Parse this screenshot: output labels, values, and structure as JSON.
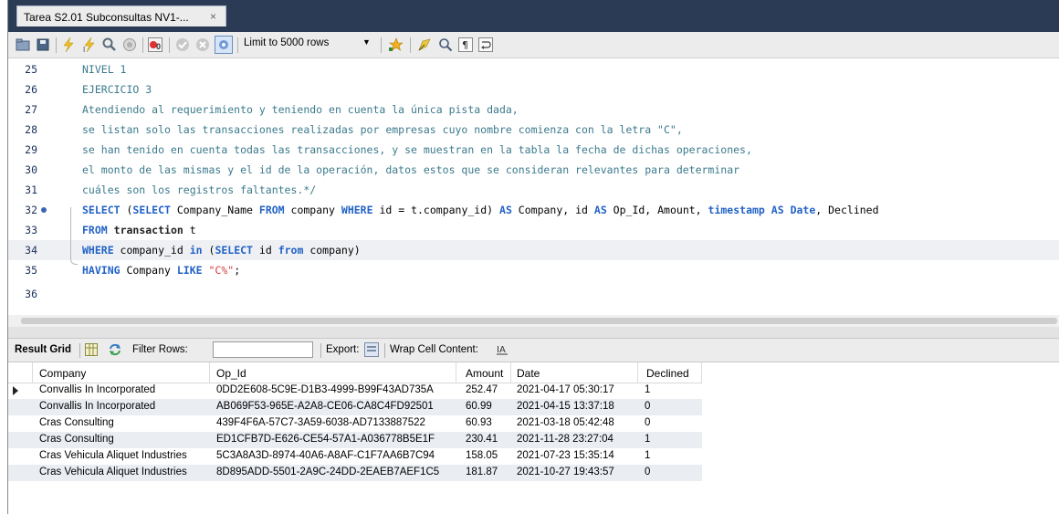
{
  "tab": {
    "title": "Tarea S2.01 Subconsultas NV1-...",
    "close": "×"
  },
  "toolbar": {
    "limit_label": "Limit to 5000 rows"
  },
  "editor": {
    "lines": [
      {
        "num": "25",
        "text": "NIVEL 1"
      },
      {
        "num": "26",
        "text": "EJERCICIO 3"
      },
      {
        "num": "27",
        "text": "Atendiendo al requerimiento y teniendo en cuenta la única pista dada,"
      },
      {
        "num": "28",
        "text": "se listan solo las transacciones realizadas por empresas cuyo nombre comienza con la letra \"C\","
      },
      {
        "num": "29",
        "text": "se han tenido en cuenta todas las transacciones, y se muestran en la tabla la fecha de dichas operaciones,"
      },
      {
        "num": "30",
        "text": "el monto de las mismas y el id de la operación, datos estos que se consideran relevantes para determinar"
      },
      {
        "num": "31",
        "text": "cuáles son los registros faltantes.*/"
      },
      {
        "num": "32",
        "parts": [
          "SELECT",
          " (",
          "SELECT",
          " Company_Name ",
          "FROM",
          " company ",
          "WHERE",
          " id = t.company_id) ",
          "AS",
          " Company, id ",
          "AS",
          " Op_Id, Amount, ",
          "timestamp",
          " ",
          "AS",
          " ",
          "Date",
          ", Declined"
        ]
      },
      {
        "num": "33",
        "parts": [
          "FROM",
          " ",
          "transaction",
          " t"
        ]
      },
      {
        "num": "34",
        "parts": [
          "WHERE",
          " company_id ",
          "in",
          " (",
          "SELECT",
          " id ",
          "from",
          " company)"
        ]
      },
      {
        "num": "35",
        "parts": [
          "HAVING",
          " Company ",
          "LIKE",
          " ",
          "\"C%\"",
          ";"
        ]
      },
      {
        "num": "36",
        "text": ""
      }
    ]
  },
  "result_toolbar": {
    "result_grid": "Result Grid",
    "filter_rows": "Filter Rows:",
    "export": "Export:",
    "wrap": "Wrap Cell Content:"
  },
  "grid": {
    "columns": [
      "Company",
      "Op_Id",
      "Amount",
      "Date",
      "Declined"
    ],
    "rows": [
      [
        "Convallis In Incorporated",
        "0DD2E608-5C9E-D1B3-4999-B99F43AD735A",
        "252.47",
        "2021-04-17 05:30:17",
        "1"
      ],
      [
        "Convallis In Incorporated",
        "AB069F53-965E-A2A8-CE06-CA8C4FD92501",
        "60.99",
        "2021-04-15 13:37:18",
        "0"
      ],
      [
        "Cras Consulting",
        "439F4F6A-57C7-3A59-6038-AD7133887522",
        "60.93",
        "2021-03-18 05:42:48",
        "0"
      ],
      [
        "Cras Consulting",
        "ED1CFB7D-E626-CE54-57A1-A036778B5E1F",
        "230.41",
        "2021-11-28 23:27:04",
        "1"
      ],
      [
        "Cras Vehicula Aliquet Industries",
        "5C3A8A3D-8974-40A6-A8AF-C1F7AA6B7C94",
        "158.05",
        "2021-07-23 15:35:14",
        "1"
      ],
      [
        "Cras Vehicula Aliquet Industries",
        "8D895ADD-5501-2A9C-24DD-2EAEB7AEF1C5",
        "181.87",
        "2021-10-27 19:43:57",
        "0"
      ]
    ]
  }
}
